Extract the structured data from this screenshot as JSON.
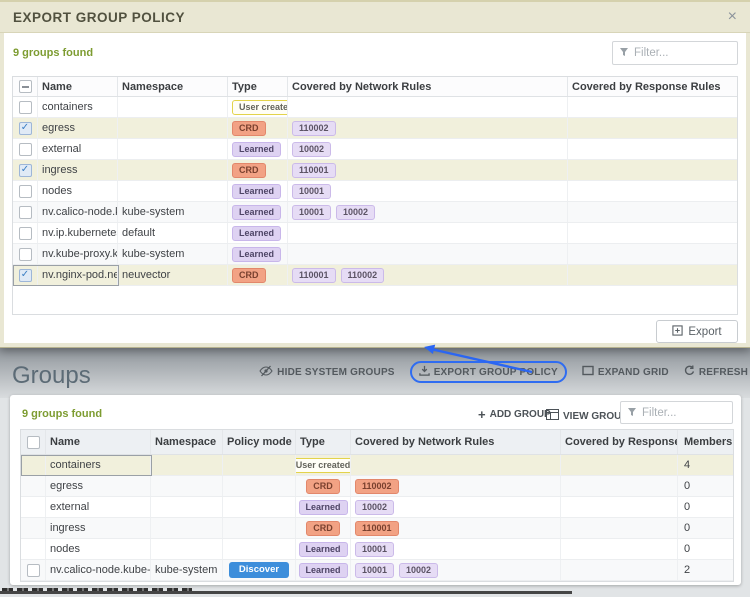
{
  "ui": {
    "check_glyph": "✓",
    "plus_glyph": "+"
  },
  "modal": {
    "title": "EXPORT GROUP POLICY",
    "close_glyph": "×",
    "count_text": "9 groups found",
    "filter_placeholder": "Filter...",
    "export_button_label": "Export",
    "table": {
      "headers": {
        "name": "Name",
        "namespace": "Namespace",
        "type": "Type",
        "network": "Covered by Network Rules",
        "response": "Covered by Response Rules"
      },
      "rows": [
        {
          "name": "containers",
          "namespace": "",
          "type": "User created",
          "network_rules": [],
          "checked": false
        },
        {
          "name": "egress",
          "namespace": "",
          "type": "CRD",
          "network_rules": [
            "110002"
          ],
          "checked": true
        },
        {
          "name": "external",
          "namespace": "",
          "type": "Learned",
          "network_rules": [
            "10002"
          ],
          "checked": false
        },
        {
          "name": "ingress",
          "namespace": "",
          "type": "CRD",
          "network_rules": [
            "110001"
          ],
          "checked": true
        },
        {
          "name": "nodes",
          "namespace": "",
          "type": "Learned",
          "network_rules": [
            "10001"
          ],
          "checked": false
        },
        {
          "name": "nv.calico-node.kub",
          "namespace": "kube-system",
          "type": "Learned",
          "network_rules": [
            "10001",
            "10002"
          ],
          "checked": false
        },
        {
          "name": "nv.ip.kubernetes.d",
          "namespace": "default",
          "type": "Learned",
          "network_rules": [],
          "checked": false
        },
        {
          "name": "nv.kube-proxy.kub",
          "namespace": "kube-system",
          "type": "Learned",
          "network_rules": [],
          "checked": false
        },
        {
          "name": "nv.nginx-pod.neuv",
          "namespace": "neuvector",
          "type": "CRD",
          "network_rules": [
            "110001",
            "110002"
          ],
          "checked": true
        }
      ]
    }
  },
  "page": {
    "title": "Groups",
    "toolbar": {
      "hide_system_groups": "HIDE SYSTEM GROUPS",
      "export_group_policy": "EXPORT GROUP POLICY",
      "expand_grid": "EXPAND GRID",
      "refresh": "REFRESH"
    },
    "count_text": "9 groups found",
    "actions": {
      "add_group": "ADD GROUP",
      "view_group": "VIEW GROUP"
    },
    "filter_placeholder": "Filter...",
    "table": {
      "headers": {
        "name": "Name",
        "namespace": "Namespace",
        "policy_mode": "Policy mode",
        "type": "Type",
        "network": "Covered by Network Rules",
        "response": "Covered by Response R..",
        "members": "Members"
      },
      "rows": [
        {
          "name": "containers",
          "namespace": "",
          "policy_mode": "",
          "type": "User created",
          "network_rules": [],
          "members": "4"
        },
        {
          "name": "egress",
          "namespace": "",
          "policy_mode": "",
          "type": "CRD",
          "network_rules": [
            "110002"
          ],
          "members": "0"
        },
        {
          "name": "external",
          "namespace": "",
          "policy_mode": "",
          "type": "Learned",
          "network_rules": [
            "10002"
          ],
          "members": "0"
        },
        {
          "name": "ingress",
          "namespace": "",
          "policy_mode": "",
          "type": "CRD",
          "network_rules": [
            "110001"
          ],
          "members": "0"
        },
        {
          "name": "nodes",
          "namespace": "",
          "policy_mode": "",
          "type": "Learned",
          "network_rules": [
            "10001"
          ],
          "members": "0"
        },
        {
          "name": "nv.calico-node.kube-sys",
          "namespace": "kube-system",
          "policy_mode": "Discover",
          "type": "Learned",
          "network_rules": [
            "10001",
            "10002"
          ],
          "members": "2"
        }
      ]
    }
  },
  "colors": {
    "accent_green": "#7d9c31",
    "annotation_blue": "#2b66f2",
    "crd_badge_bg": "#f2a284",
    "learned_badge_bg": "#ded2f2",
    "user_created_border": "#e3d34b",
    "discover_bg": "#3d8edb",
    "modal_chrome": "#e9e7d3",
    "selected_row_bg": "#f1f0dc"
  }
}
